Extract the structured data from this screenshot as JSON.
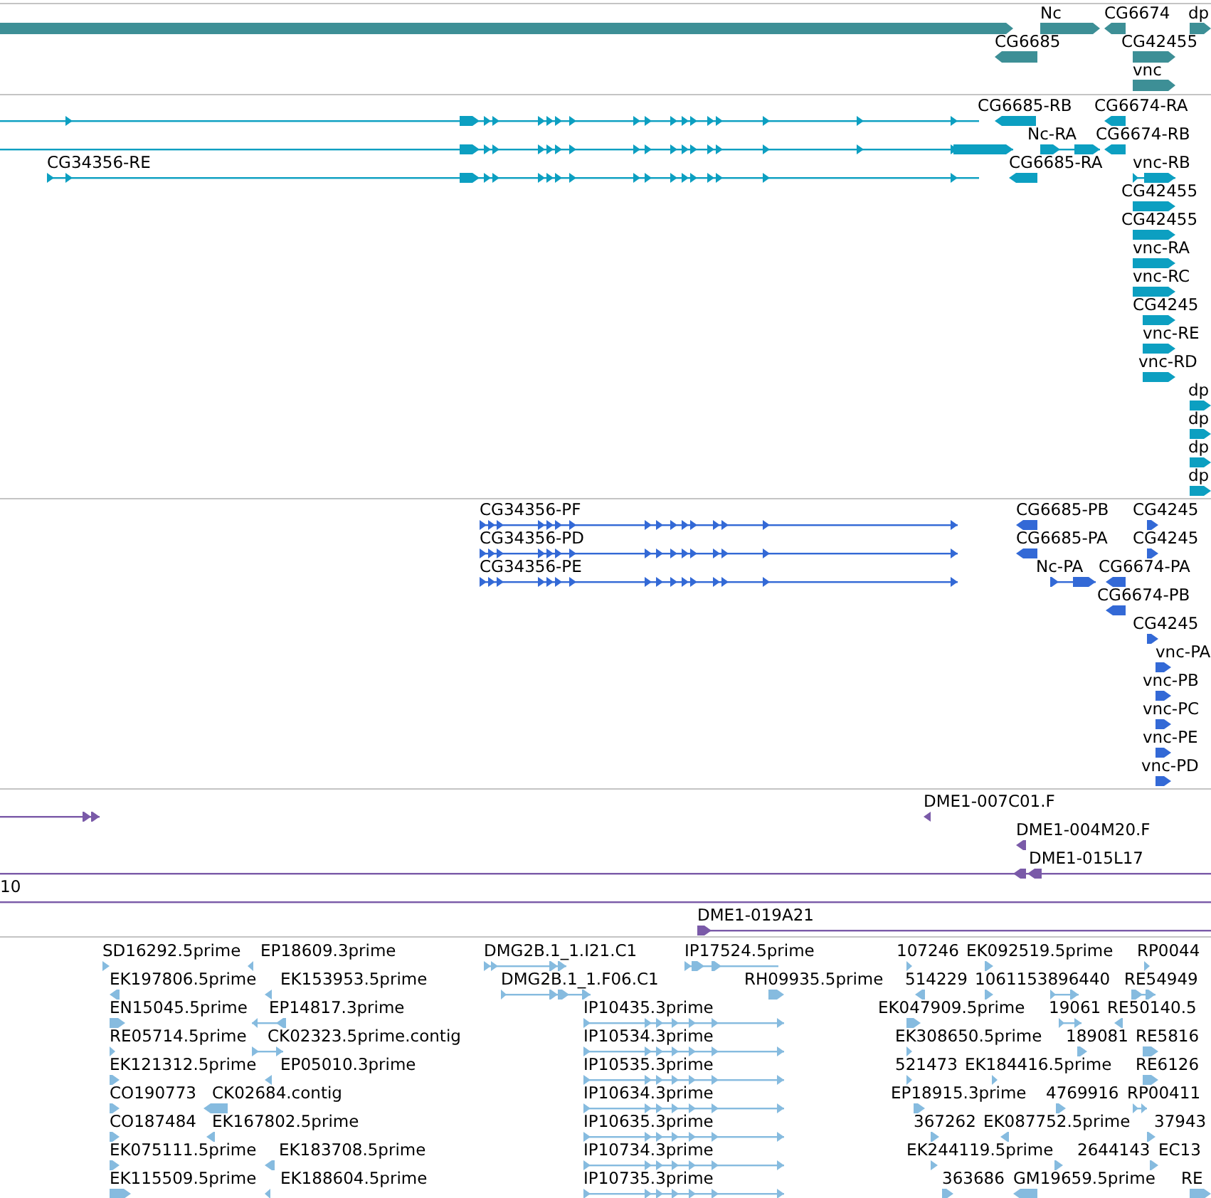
{
  "tracks": [
    {
      "color": "#3d8f96",
      "features": [
        {
          "reverse": false
        },
        {
          "label": "Nc",
          "reverse": false
        },
        {
          "label": "CG6674",
          "reverse": true
        },
        {
          "label": "dp",
          "reverse": false
        },
        {
          "label": "CG6685",
          "reverse": true
        },
        {
          "label": "CG42455",
          "reverse": false
        },
        {
          "label": "vnc",
          "reverse": false
        }
      ]
    },
    {
      "color": "#0c9fc1",
      "features": [
        {
          "reverse": false
        },
        {
          "label": "CG6685-RB",
          "reverse": true
        },
        {
          "label": "CG6674-RA",
          "reverse": true
        },
        {
          "reverse": false
        },
        {
          "label": "Nc-RA",
          "reverse": false
        },
        {
          "label": "CG6674-RB",
          "reverse": true
        },
        {
          "label": "CG34356-RE",
          "reverse": false
        },
        {
          "label": "CG6685-RA",
          "reverse": true
        },
        {
          "label": "vnc-RB",
          "reverse": false
        },
        {
          "label": "CG42455",
          "reverse": false
        },
        {
          "label": "CG42455",
          "reverse": false
        },
        {
          "label": "vnc-RA",
          "reverse": false
        },
        {
          "label": "vnc-RC",
          "reverse": false
        },
        {
          "label": "CG4245",
          "reverse": false
        },
        {
          "label": "vnc-RE",
          "reverse": false
        },
        {
          "label": "vnc-RD",
          "reverse": false
        },
        {
          "label": "dp",
          "reverse": false
        },
        {
          "label": "dp",
          "reverse": false
        },
        {
          "label": "dp",
          "reverse": false
        },
        {
          "label": "dp",
          "reverse": false
        }
      ]
    },
    {
      "color": "#3369d6",
      "features": [
        {
          "label": "CG34356-PF",
          "reverse": false
        },
        {
          "label": "CG6685-PB",
          "reverse": true
        },
        {
          "label": "CG4245",
          "reverse": false
        },
        {
          "label": "CG34356-PD",
          "reverse": false
        },
        {
          "label": "CG6685-PA",
          "reverse": true
        },
        {
          "label": "CG4245",
          "reverse": false
        },
        {
          "label": "CG34356-PE",
          "reverse": false
        },
        {
          "label": "Nc-PA",
          "reverse": false
        },
        {
          "label": "CG6674-PA",
          "reverse": true
        },
        {
          "label": "CG6674-PB",
          "reverse": true
        },
        {
          "label": "CG4245",
          "reverse": false
        },
        {
          "label": "vnc-PA",
          "reverse": false
        },
        {
          "label": "vnc-PB",
          "reverse": false
        },
        {
          "label": "vnc-PC",
          "reverse": false
        },
        {
          "label": "vnc-PE",
          "reverse": false
        },
        {
          "label": "vnc-PD",
          "reverse": false
        }
      ]
    },
    {
      "color": "#7a5aa8",
      "features": [
        {
          "reverse": false
        },
        {
          "label": "DME1-007C01.F",
          "reverse": true
        },
        {
          "label": "DME1-004M20.F",
          "reverse": true
        },
        {
          "label": "DME1-015L17",
          "reverse": true
        },
        {
          "label": "10"
        },
        {
          "label": "DME1-019A21",
          "reverse": false
        }
      ]
    },
    {
      "color": "#86bbdf",
      "features": [
        {
          "label": "SD16292.5prime",
          "reverse": false
        },
        {
          "label": "EP18609.3prime",
          "reverse": true
        },
        {
          "label": "DMG2B.1_1.I21.C1",
          "reverse": false
        },
        {
          "label": "IP17524.5prime",
          "reverse": false
        },
        {
          "label": "107246",
          "reverse": false
        },
        {
          "label": "EK092519.5prime",
          "reverse": false
        },
        {
          "label": "RP0044",
          "reverse": false
        },
        {
          "label": "EK197806.5prime",
          "reverse": true
        },
        {
          "label": "EK153953.5prime",
          "reverse": true
        },
        {
          "label": "DMG2B.1_1.F06.C1",
          "reverse": false
        },
        {
          "label": "RH09935.5prime",
          "reverse": false
        },
        {
          "label": "514229",
          "reverse": true
        },
        {
          "label": "1061153896440",
          "reverse": false
        },
        {
          "reverse": false
        },
        {
          "label": "RE54949",
          "reverse": false
        },
        {
          "label": "EN15045.5prime",
          "reverse": false
        },
        {
          "label": "EP14817.3prime",
          "reverse": true
        },
        {
          "label": "IP10435.3prime",
          "reverse": false
        },
        {
          "label": "EK047909.5prime",
          "reverse": false
        },
        {
          "label": "19061",
          "reverse": false
        },
        {
          "label": "RE50140.5",
          "reverse": true
        },
        {
          "label": "RE05714.5prime",
          "reverse": false
        },
        {
          "label": "CK02323.5prime.contig",
          "reverse": false
        },
        {
          "label": "IP10534.3prime",
          "reverse": false
        },
        {
          "label": "EK308650.5prime",
          "reverse": false
        },
        {
          "label": "189081",
          "reverse": false
        },
        {
          "label": "RE5816",
          "reverse": false
        },
        {
          "label": "EK121312.5prime",
          "reverse": false
        },
        {
          "label": "EP05010.3prime",
          "reverse": true
        },
        {
          "label": "IP10535.3prime",
          "reverse": false
        },
        {
          "label": "521473",
          "reverse": false
        },
        {
          "label": "EK184416.5prime",
          "reverse": false
        },
        {
          "label": "RE6126",
          "reverse": false
        },
        {
          "label": "CO190773",
          "reverse": false
        },
        {
          "label": "CK02684.contig",
          "reverse": true
        },
        {
          "label": "IP10634.3prime",
          "reverse": false
        },
        {
          "label": "EP18915.3prime",
          "reverse": false
        },
        {
          "label": "4769916",
          "reverse": false
        },
        {
          "label": "RP00411",
          "reverse": false
        },
        {
          "label": "CO187484",
          "reverse": false
        },
        {
          "label": "EK167802.5prime",
          "reverse": true
        },
        {
          "label": "IP10635.3prime",
          "reverse": false
        },
        {
          "label": "367262",
          "reverse": false
        },
        {
          "label": "EK087752.5prime",
          "reverse": true
        },
        {
          "label": "37943",
          "reverse": false
        },
        {
          "label": "EK075111.5prime",
          "reverse": false
        },
        {
          "label": "EK183708.5prime",
          "reverse": true
        },
        {
          "label": "IP10734.3prime",
          "reverse": false
        },
        {
          "label": "EK244119.5prime",
          "reverse": false
        },
        {
          "label": "2644143",
          "reverse": false
        },
        {
          "label": "EC13",
          "reverse": false
        },
        {
          "label": "EK115509.5prime",
          "reverse": false
        },
        {
          "label": "EK188604.5prime",
          "reverse": true
        },
        {
          "label": "IP10735.3prime",
          "reverse": false
        },
        {
          "label": "363686",
          "reverse": false
        },
        {
          "label": "GM19659.5prime",
          "reverse": true
        },
        {
          "label": "RE",
          "reverse": false
        }
      ]
    }
  ]
}
